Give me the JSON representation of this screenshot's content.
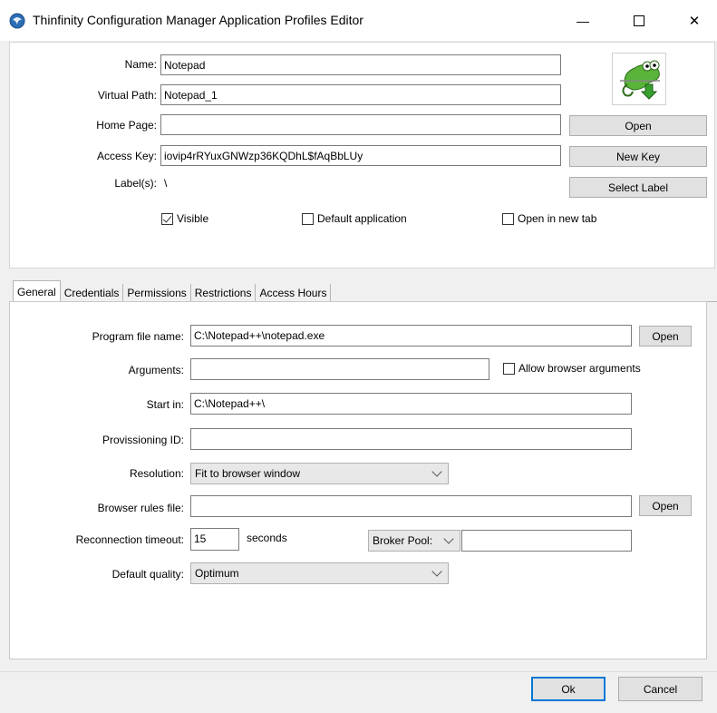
{
  "window": {
    "title": "Thinfinity Configuration Manager Application Profiles Editor",
    "minimize": "—",
    "maximize": "☐",
    "close": "✕"
  },
  "profile": {
    "name_label": "Name:",
    "name_value": "Notepad",
    "virtual_path_label": "Virtual Path:",
    "virtual_path_value": "Notepad_1",
    "home_page_label": "Home Page:",
    "home_page_value": "",
    "access_key_label": "Access Key:",
    "access_key_value": "iovip4rRYuxGNWzp36KQDhL$fAqBbLUy",
    "labels_label": "Label(s):",
    "labels_value": "\\",
    "open_button": "Open",
    "new_key_button": "New Key",
    "select_label_button": "Select Label",
    "visible_label": "Visible",
    "visible_checked": true,
    "default_app_label": "Default application",
    "default_app_checked": false,
    "new_tab_label": "Open in new tab",
    "new_tab_checked": false,
    "icon": "notepad-plus-chameleon-icon"
  },
  "tabs": [
    {
      "label": "General",
      "active": true
    },
    {
      "label": "Credentials",
      "active": false
    },
    {
      "label": "Permissions",
      "active": false
    },
    {
      "label": "Restrictions",
      "active": false
    },
    {
      "label": "Access Hours",
      "active": false
    }
  ],
  "general": {
    "program_label": "Program file name:",
    "program_value": "C:\\Notepad++\\notepad.exe",
    "program_open": "Open",
    "arguments_label": "Arguments:",
    "arguments_value": "",
    "allow_args_label": "Allow browser arguments",
    "allow_args_checked": false,
    "start_in_label": "Start in:",
    "start_in_value": "C:\\Notepad++\\",
    "provisioning_label": "Provissioning ID:",
    "provisioning_value": "",
    "resolution_label": "Resolution:",
    "resolution_value": "Fit to browser window",
    "browser_rules_label": "Browser rules file:",
    "browser_rules_value": "",
    "browser_rules_open": "Open",
    "reconnection_label": "Reconnection timeout:",
    "reconnection_value": "15",
    "seconds_label": "seconds",
    "broker_pool_label": "Broker Pool:",
    "broker_pool_value": "",
    "quality_label": "Default quality:",
    "quality_value": "Optimum"
  },
  "footer": {
    "ok": "Ok",
    "cancel": "Cancel"
  },
  "colors": {
    "accent": "#0078d7",
    "button_bg": "#e1e1e1",
    "window_bg": "#f0f0f0"
  }
}
